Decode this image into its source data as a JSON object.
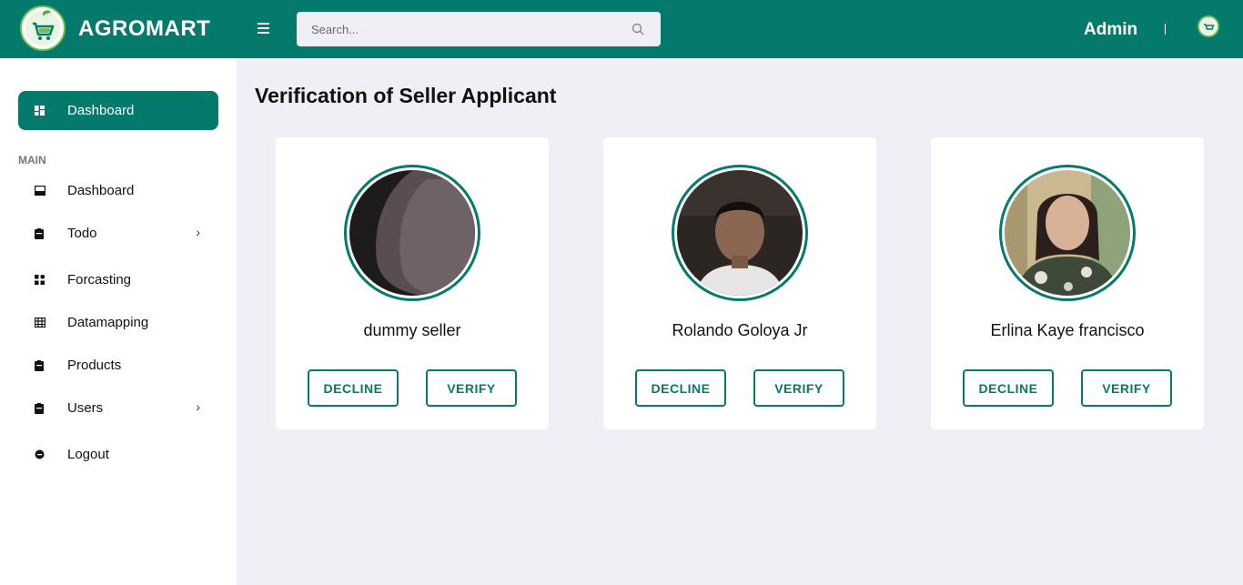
{
  "app": {
    "brand": "AGROMART",
    "admin_label": "Admin"
  },
  "search": {
    "placeholder": "Search..."
  },
  "sidebar": {
    "active_item": "Dashboard",
    "section_label": "MAIN",
    "items": [
      {
        "label": "Dashboard",
        "icon": "inbox-icon",
        "has_submenu": false
      },
      {
        "label": "Todo",
        "icon": "clipboard-icon",
        "has_submenu": true
      },
      {
        "label": "Forcasting",
        "icon": "grid-icon",
        "has_submenu": false
      },
      {
        "label": "Datamapping",
        "icon": "table-icon",
        "has_submenu": false
      },
      {
        "label": "Products",
        "icon": "clipboard-icon",
        "has_submenu": false
      },
      {
        "label": "Users",
        "icon": "clipboard-icon",
        "has_submenu": true
      },
      {
        "label": "Logout",
        "icon": "logout-icon",
        "has_submenu": false
      }
    ],
    "chevron": "›"
  },
  "main": {
    "title": "Verification of Seller Applicant",
    "applicants": [
      {
        "name": "dummy seller",
        "decline_label": "DECLINE",
        "verify_label": "VERIFY"
      },
      {
        "name": "Rolando Goloya Jr",
        "decline_label": "DECLINE",
        "verify_label": "VERIFY"
      },
      {
        "name": "Erlina Kaye francisco",
        "decline_label": "DECLINE",
        "verify_label": "VERIFY"
      }
    ]
  },
  "colors": {
    "primary": "#047a6c",
    "background": "#f0eff5",
    "logo_accent": "#6cc24a"
  }
}
